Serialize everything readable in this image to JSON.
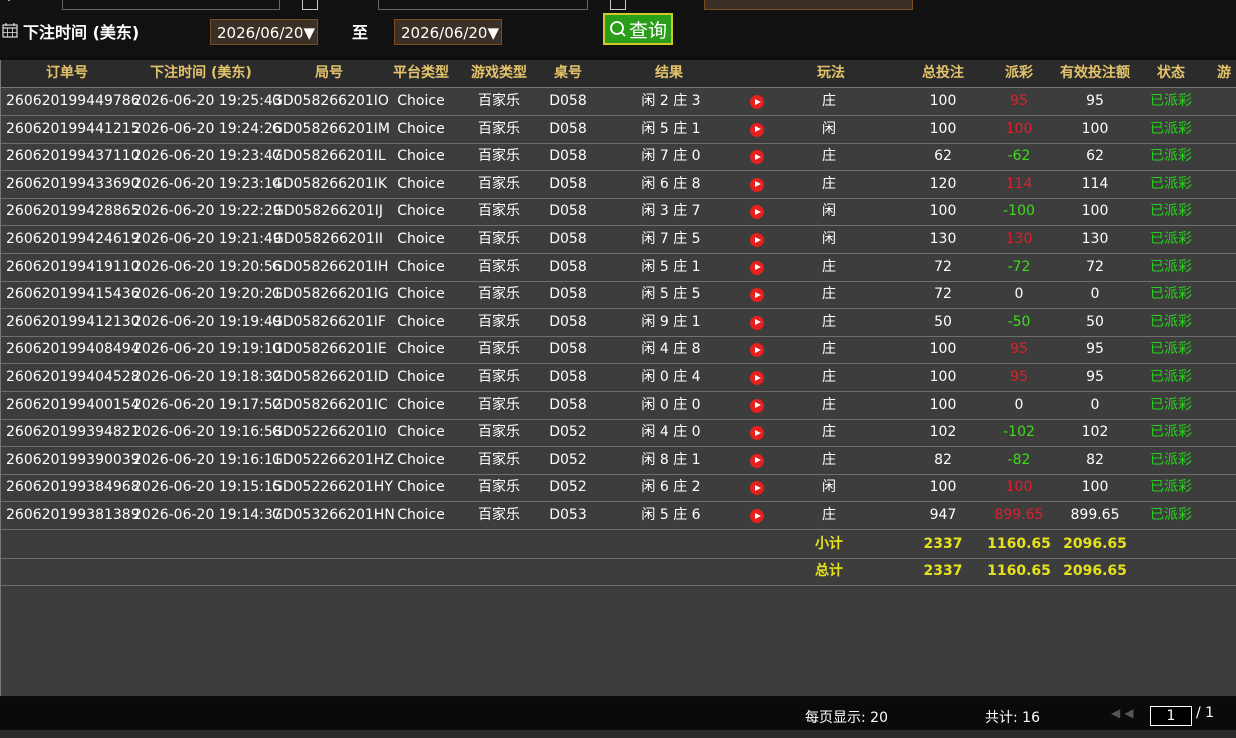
{
  "filters": {
    "date_label": "下注时间 (美东)",
    "start_date": "2026/06/20▼",
    "to_label": "至",
    "end_date": "2026/06/20▼",
    "query_label": "查询"
  },
  "columns": [
    "订单号",
    "下注时间 (美东)",
    "局号",
    "平台类型",
    "游戏类型",
    "桌号",
    "结果",
    "玩法",
    "总投注",
    "派彩",
    "有效投注额",
    "状态",
    "游"
  ],
  "rows": [
    {
      "order": "260620199449786",
      "time": "2026-06-20 19:25:43",
      "game": "GD058266201IO",
      "platform": "Choice",
      "gtype": "百家乐",
      "table": "D058",
      "result": "闲 2 庄 3",
      "play": "庄",
      "bet": "100",
      "payout": "95",
      "payout_tone": "pos",
      "valid": "95",
      "status": "已派彩"
    },
    {
      "order": "260620199441215",
      "time": "2026-06-20 19:24:26",
      "game": "GD058266201IM",
      "platform": "Choice",
      "gtype": "百家乐",
      "table": "D058",
      "result": "闲 5 庄 1",
      "play": "闲",
      "bet": "100",
      "payout": "100",
      "payout_tone": "pos",
      "valid": "100",
      "status": "已派彩"
    },
    {
      "order": "260620199437110",
      "time": "2026-06-20 19:23:47",
      "game": "GD058266201IL",
      "platform": "Choice",
      "gtype": "百家乐",
      "table": "D058",
      "result": "闲 7 庄 0",
      "play": "庄",
      "bet": "62",
      "payout": "-62",
      "payout_tone": "neg",
      "valid": "62",
      "status": "已派彩"
    },
    {
      "order": "260620199433690",
      "time": "2026-06-20 19:23:14",
      "game": "GD058266201IK",
      "platform": "Choice",
      "gtype": "百家乐",
      "table": "D058",
      "result": "闲 6 庄 8",
      "play": "庄",
      "bet": "120",
      "payout": "114",
      "payout_tone": "pos",
      "valid": "114",
      "status": "已派彩"
    },
    {
      "order": "260620199428865",
      "time": "2026-06-20 19:22:29",
      "game": "GD058266201IJ",
      "platform": "Choice",
      "gtype": "百家乐",
      "table": "D058",
      "result": "闲 3 庄 7",
      "play": "闲",
      "bet": "100",
      "payout": "-100",
      "payout_tone": "neg",
      "valid": "100",
      "status": "已派彩"
    },
    {
      "order": "260620199424619",
      "time": "2026-06-20 19:21:49",
      "game": "GD058266201II",
      "platform": "Choice",
      "gtype": "百家乐",
      "table": "D058",
      "result": "闲 7 庄 5",
      "play": "闲",
      "bet": "130",
      "payout": "130",
      "payout_tone": "pos",
      "valid": "130",
      "status": "已派彩"
    },
    {
      "order": "260620199419110",
      "time": "2026-06-20 19:20:56",
      "game": "GD058266201IH",
      "platform": "Choice",
      "gtype": "百家乐",
      "table": "D058",
      "result": "闲 5 庄 1",
      "play": "庄",
      "bet": "72",
      "payout": "-72",
      "payout_tone": "neg",
      "valid": "72",
      "status": "已派彩"
    },
    {
      "order": "260620199415436",
      "time": "2026-06-20 19:20:21",
      "game": "GD058266201IG",
      "platform": "Choice",
      "gtype": "百家乐",
      "table": "D058",
      "result": "闲 5 庄 5",
      "play": "庄",
      "bet": "72",
      "payout": "0",
      "payout_tone": "zero",
      "valid": "0",
      "status": "已派彩"
    },
    {
      "order": "260620199412130",
      "time": "2026-06-20 19:19:49",
      "game": "GD058266201IF",
      "platform": "Choice",
      "gtype": "百家乐",
      "table": "D058",
      "result": "闲 9 庄 1",
      "play": "庄",
      "bet": "50",
      "payout": "-50",
      "payout_tone": "neg",
      "valid": "50",
      "status": "已派彩"
    },
    {
      "order": "260620199408494",
      "time": "2026-06-20 19:19:10",
      "game": "GD058266201IE",
      "platform": "Choice",
      "gtype": "百家乐",
      "table": "D058",
      "result": "闲 4 庄 8",
      "play": "庄",
      "bet": "100",
      "payout": "95",
      "payout_tone": "pos",
      "valid": "95",
      "status": "已派彩"
    },
    {
      "order": "260620199404528",
      "time": "2026-06-20 19:18:32",
      "game": "GD058266201ID",
      "platform": "Choice",
      "gtype": "百家乐",
      "table": "D058",
      "result": "闲 0 庄 4",
      "play": "庄",
      "bet": "100",
      "payout": "95",
      "payout_tone": "pos",
      "valid": "95",
      "status": "已派彩"
    },
    {
      "order": "260620199400154",
      "time": "2026-06-20 19:17:52",
      "game": "GD058266201IC",
      "platform": "Choice",
      "gtype": "百家乐",
      "table": "D058",
      "result": "闲 0 庄 0",
      "play": "庄",
      "bet": "100",
      "payout": "0",
      "payout_tone": "zero",
      "valid": "0",
      "status": "已派彩"
    },
    {
      "order": "260620199394821",
      "time": "2026-06-20 19:16:58",
      "game": "GD052266201I0",
      "platform": "Choice",
      "gtype": "百家乐",
      "table": "D052",
      "result": "闲 4 庄 0",
      "play": "庄",
      "bet": "102",
      "payout": "-102",
      "payout_tone": "neg",
      "valid": "102",
      "status": "已派彩"
    },
    {
      "order": "260620199390039",
      "time": "2026-06-20 19:16:11",
      "game": "GD052266201HZ",
      "platform": "Choice",
      "gtype": "百家乐",
      "table": "D052",
      "result": "闲 8 庄 1",
      "play": "庄",
      "bet": "82",
      "payout": "-82",
      "payout_tone": "neg",
      "valid": "82",
      "status": "已派彩"
    },
    {
      "order": "260620199384968",
      "time": "2026-06-20 19:15:15",
      "game": "GD052266201HY",
      "platform": "Choice",
      "gtype": "百家乐",
      "table": "D052",
      "result": "闲 6 庄 2",
      "play": "闲",
      "bet": "100",
      "payout": "100",
      "payout_tone": "pos",
      "valid": "100",
      "status": "已派彩"
    },
    {
      "order": "260620199381389",
      "time": "2026-06-20 19:14:37",
      "game": "GD053266201HN",
      "platform": "Choice",
      "gtype": "百家乐",
      "table": "D053",
      "result": "闲 5 庄 6",
      "play": "庄",
      "bet": "947",
      "payout": "899.65",
      "payout_tone": "pos",
      "valid": "899.65",
      "status": "已派彩"
    }
  ],
  "summary": {
    "subtotal": {
      "label": "小计",
      "bet": "2337",
      "payout": "1160.65",
      "valid": "2096.65"
    },
    "total": {
      "label": "总计",
      "bet": "2337",
      "payout": "1160.65",
      "valid": "2096.65"
    }
  },
  "pagination": {
    "per_page": "每页显示: 20",
    "total_count": "共计: 16",
    "current_page": "1",
    "total_pages": "/  1"
  },
  "icons": {
    "calendar": "calendar-icon",
    "search": "search-icon",
    "play": "play-video-icon"
  },
  "colors": {
    "header_text": "#e4c36b",
    "payout_positive": "#e01f2c",
    "payout_negative": "#3ddc18",
    "status_done": "#28d21b",
    "summary_text": "#e6e21b",
    "query_button": "#2a9d19"
  }
}
